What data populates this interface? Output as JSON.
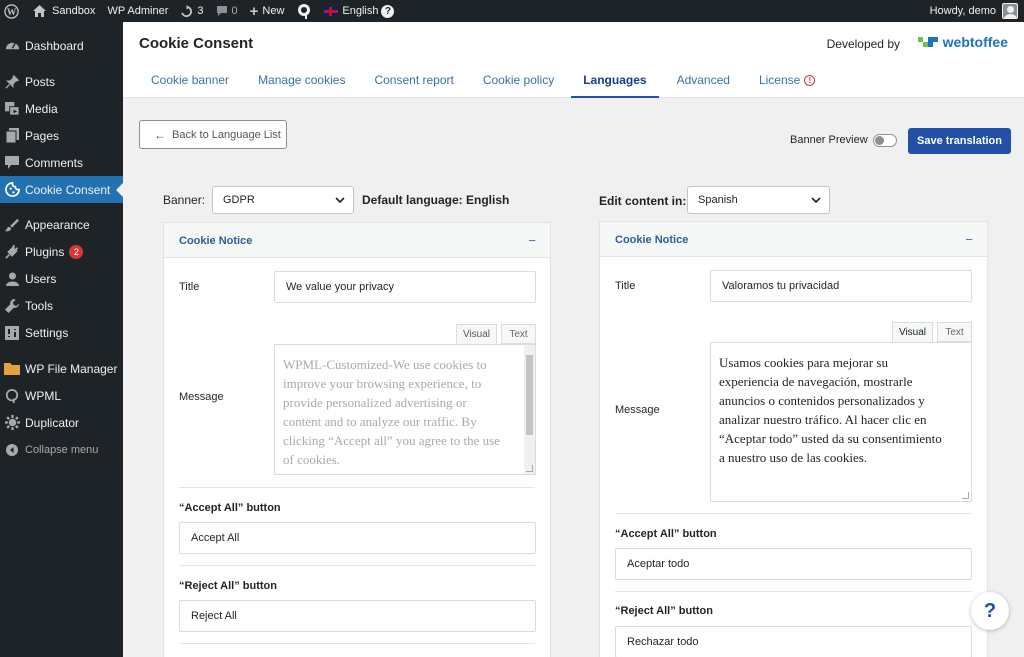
{
  "admin_bar": {
    "site_name": "Sandbox",
    "wp_adminer": "WP Adminer",
    "updates_count": "3",
    "comments_count": "0",
    "new_label": "New",
    "language_label": "English",
    "language_help": "?",
    "howdy": "Howdy, demo"
  },
  "sidebar": {
    "items": [
      {
        "label": "Dashboard",
        "icon": "dashboard-icon"
      },
      {
        "label": "Posts",
        "icon": "pin-icon"
      },
      {
        "label": "Media",
        "icon": "media-icon"
      },
      {
        "label": "Pages",
        "icon": "pages-icon"
      },
      {
        "label": "Comments",
        "icon": "comment-icon"
      },
      {
        "label": "Cookie Consent",
        "icon": "cookie-icon"
      },
      {
        "label": "Appearance",
        "icon": "brush-icon"
      },
      {
        "label": "Plugins",
        "icon": "plug-icon",
        "badge": "2"
      },
      {
        "label": "Users",
        "icon": "user-icon"
      },
      {
        "label": "Tools",
        "icon": "wrench-icon"
      },
      {
        "label": "Settings",
        "icon": "settings-icon"
      },
      {
        "label": "WP File Manager",
        "icon": "folder-icon"
      },
      {
        "label": "WPML",
        "icon": "wpml-icon"
      },
      {
        "label": "Duplicator",
        "icon": "duplicator-icon"
      }
    ],
    "collapse_label": "Collapse menu"
  },
  "header": {
    "title": "Cookie Consent",
    "developed_by": "Developed by",
    "brand": "webtoffee",
    "tabs": [
      {
        "label": "Cookie banner"
      },
      {
        "label": "Manage cookies"
      },
      {
        "label": "Consent report"
      },
      {
        "label": "Cookie policy"
      },
      {
        "label": "Languages",
        "active": true
      },
      {
        "label": "Advanced"
      },
      {
        "label": "License",
        "error": "!"
      }
    ]
  },
  "toolbar": {
    "back_label": "Back to Language List",
    "banner_preview_label": "Banner Preview",
    "banner_preview_on": false,
    "save_label": "Save translation"
  },
  "left": {
    "banner_label": "Banner:",
    "banner_value": "GDPR",
    "default_language_label": "Default language: English",
    "panel_title": "Cookie Notice",
    "panel_collapse": "−",
    "title_label": "Title",
    "title_value": "We value your privacy",
    "message_label": "Message",
    "visual_tab": "Visual",
    "text_tab": "Text",
    "message_lines": [
      "WPML-Customized-We use cookies to",
      "improve your browsing experience, to",
      "provide personalized advertising or",
      "content and to analyze our traffic. By",
      "clicking “Accept all” you agree to the use",
      "of cookies."
    ],
    "accept_label": "“Accept All” button",
    "accept_value": "Accept All",
    "reject_label": "“Reject All” button",
    "reject_value": "Reject All"
  },
  "right": {
    "edit_label": "Edit content in:",
    "edit_value": "Spanish",
    "panel_title": "Cookie Notice",
    "panel_collapse": "−",
    "title_label": "Title",
    "title_value": "Valoramos tu privacidad",
    "message_label": "Message",
    "visual_tab": "Visual",
    "text_tab": "Text",
    "message_lines": [
      "Usamos cookies para mejorar su",
      "experiencia de navegación, mostrarle",
      "anuncios o contenidos personalizados y",
      "analizar nuestro tráfico. Al hacer clic en",
      "“Aceptar todo” usted da su consentimiento",
      "a nuestro uso de las cookies."
    ],
    "accept_label": "“Accept All” button",
    "accept_value": "Aceptar todo",
    "reject_label": "“Reject All” button",
    "reject_value": "Rechazar todo"
  },
  "help_label": "?",
  "colors": {
    "accent": "#2150a6",
    "sidebar_bg": "#1d2327",
    "sidebar_active": "#2271b1",
    "error": "#d63638"
  }
}
